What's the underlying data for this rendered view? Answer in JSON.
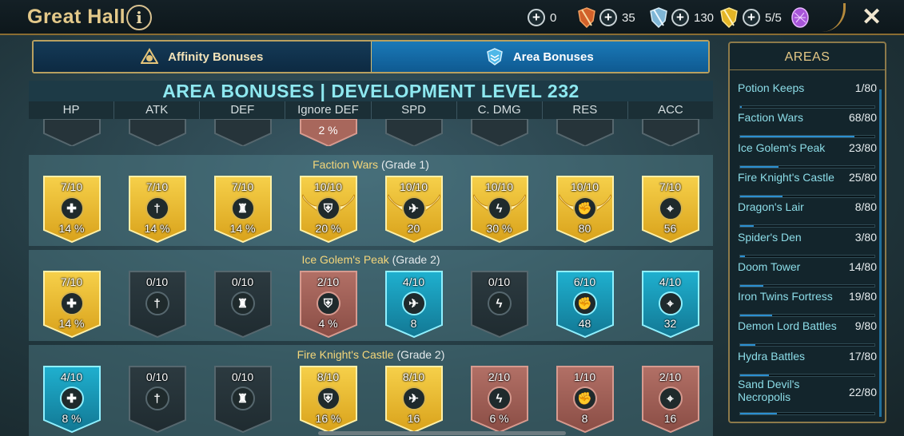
{
  "header": {
    "title": "Great Hall",
    "resources": [
      {
        "value": "0",
        "icon": "orange-shield-icon"
      },
      {
        "value": "35",
        "icon": "blue-shield-icon"
      },
      {
        "value": "130",
        "icon": "gold-shield-icon"
      },
      {
        "value": "5/5",
        "icon": "purple-gem-icon"
      }
    ]
  },
  "tabs": {
    "affinity_label": "Affinity Bonuses",
    "area_label": "Area Bonuses",
    "active": "area"
  },
  "main": {
    "heading": "AREA BONUSES | DEVELOPMENT LEVEL 232",
    "columns": [
      "HP",
      "ATK",
      "DEF",
      "Ignore DEF",
      "SPD",
      "C. DMG",
      "RES",
      "ACC"
    ],
    "partial_row_value": "2 %",
    "sections": [
      {
        "name": "Faction Wars",
        "grade": "(Grade 1)",
        "badges": [
          {
            "level": "7/10",
            "value": "14 %",
            "tier": "gold",
            "wings": false
          },
          {
            "level": "7/10",
            "value": "14 %",
            "tier": "gold",
            "wings": false
          },
          {
            "level": "7/10",
            "value": "14 %",
            "tier": "gold",
            "wings": false
          },
          {
            "level": "10/10",
            "value": "20 %",
            "tier": "gold",
            "wings": true
          },
          {
            "level": "10/10",
            "value": "20",
            "tier": "gold",
            "wings": true
          },
          {
            "level": "10/10",
            "value": "30 %",
            "tier": "gold",
            "wings": true
          },
          {
            "level": "10/10",
            "value": "80",
            "tier": "gold",
            "wings": true
          },
          {
            "level": "7/10",
            "value": "56",
            "tier": "gold",
            "wings": false
          }
        ]
      },
      {
        "name": "Ice Golem's Peak",
        "grade": "(Grade 2)",
        "badges": [
          {
            "level": "7/10",
            "value": "14 %",
            "tier": "gold"
          },
          {
            "level": "0/10",
            "value": "",
            "tier": "dark"
          },
          {
            "level": "0/10",
            "value": "",
            "tier": "dark"
          },
          {
            "level": "2/10",
            "value": "4 %",
            "tier": "bronze"
          },
          {
            "level": "4/10",
            "value": "8",
            "tier": "blue"
          },
          {
            "level": "0/10",
            "value": "",
            "tier": "dark"
          },
          {
            "level": "6/10",
            "value": "48",
            "tier": "blue"
          },
          {
            "level": "4/10",
            "value": "32",
            "tier": "blue"
          }
        ]
      },
      {
        "name": "Fire Knight's Castle",
        "grade": "(Grade 2)",
        "badges": [
          {
            "level": "4/10",
            "value": "8 %",
            "tier": "blue"
          },
          {
            "level": "0/10",
            "value": "",
            "tier": "dark"
          },
          {
            "level": "0/10",
            "value": "",
            "tier": "dark"
          },
          {
            "level": "8/10",
            "value": "16 %",
            "tier": "gold"
          },
          {
            "level": "8/10",
            "value": "16",
            "tier": "gold"
          },
          {
            "level": "2/10",
            "value": "6 %",
            "tier": "bronze"
          },
          {
            "level": "1/10",
            "value": "8",
            "tier": "bronze"
          },
          {
            "level": "2/10",
            "value": "16",
            "tier": "bronze"
          }
        ]
      }
    ]
  },
  "stat_icons": [
    "hp-cross-icon",
    "atk-sword-icon",
    "def-tower-icon",
    "ignore-def-armor-icon",
    "spd-bird-icon",
    "cdmg-lightning-icon",
    "res-fist-icon",
    "acc-crosshair-icon"
  ],
  "areas_panel": {
    "title": "AREAS",
    "items": [
      {
        "name": "Potion Keeps",
        "count": "1/80",
        "progress": 0.0125
      },
      {
        "name": "Faction Wars",
        "count": "68/80",
        "progress": 0.85
      },
      {
        "name": "Ice Golem's Peak",
        "count": "23/80",
        "progress": 0.2875
      },
      {
        "name": "Fire Knight's Castle",
        "count": "25/80",
        "progress": 0.3125
      },
      {
        "name": "Dragon's Lair",
        "count": "8/80",
        "progress": 0.1
      },
      {
        "name": "Spider's Den",
        "count": "3/80",
        "progress": 0.0375
      },
      {
        "name": "Doom Tower",
        "count": "14/80",
        "progress": 0.175
      },
      {
        "name": "Iron Twins Fortress",
        "count": "19/80",
        "progress": 0.2375
      },
      {
        "name": "Demon Lord Battles",
        "count": "9/80",
        "progress": 0.1125
      },
      {
        "name": "Hydra Battles",
        "count": "17/80",
        "progress": 0.2125
      },
      {
        "name": "Sand Devil's Necropolis",
        "count": "22/80",
        "progress": 0.275
      }
    ]
  },
  "colors": {
    "gold": "#f2c230",
    "blue": "#1aa3c4",
    "bronze": "#a8675c",
    "dark": "#26343a",
    "accent": "#8ee8f0"
  }
}
